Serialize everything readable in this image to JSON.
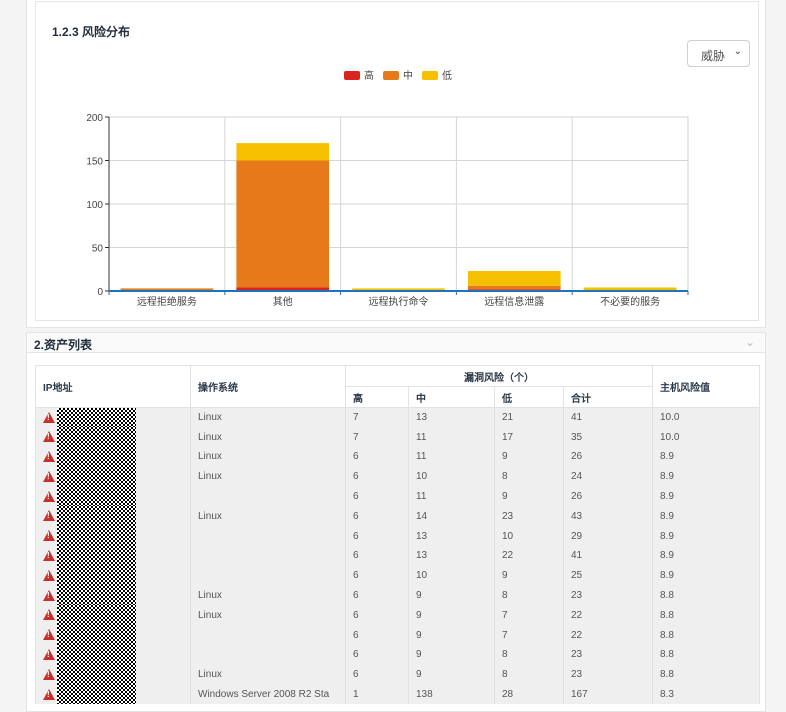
{
  "section1": {
    "title": "1.2.3 风险分布",
    "select_value": "威胁"
  },
  "chart_data": {
    "type": "bar",
    "stacked": true,
    "categories": [
      "远程拒绝服务",
      "其他",
      "远程执行命令",
      "远程信息泄露",
      "不必要的服务"
    ],
    "series": [
      {
        "name": "高",
        "color": "#d9251d",
        "values": [
          0,
          4,
          0,
          2,
          0
        ]
      },
      {
        "name": "中",
        "color": "#e67a1a",
        "values": [
          3,
          146,
          1,
          4,
          1
        ]
      },
      {
        "name": "低",
        "color": "#f5c000",
        "values": [
          0,
          20,
          2,
          17,
          3
        ]
      }
    ],
    "ylim": [
      0,
      200
    ],
    "yticks": [
      0,
      50,
      100,
      150,
      200
    ],
    "legend_position": "top-center",
    "grid": true
  },
  "section2": {
    "title": "2.资产列表",
    "headers": {
      "ip": "IP地址",
      "os": "操作系统",
      "vuln_group": "漏洞风险（个）",
      "high": "高",
      "mid": "中",
      "low": "低",
      "total": "合计",
      "host_risk": "主机风险值"
    },
    "rows": [
      {
        "os": "Linux",
        "high": "7",
        "mid": "13",
        "low": "21",
        "total": "41",
        "risk": "10.0"
      },
      {
        "os": "Linux",
        "high": "7",
        "mid": "11",
        "low": "17",
        "total": "35",
        "risk": "10.0"
      },
      {
        "os": "Linux",
        "high": "6",
        "mid": "11",
        "low": "9",
        "total": "26",
        "risk": "8.9"
      },
      {
        "os": "Linux",
        "high": "6",
        "mid": "10",
        "low": "8",
        "total": "24",
        "risk": "8.9"
      },
      {
        "os": "",
        "high": "6",
        "mid": "11",
        "low": "9",
        "total": "26",
        "risk": "8.9"
      },
      {
        "os": "Linux",
        "high": "6",
        "mid": "14",
        "low": "23",
        "total": "43",
        "risk": "8.9"
      },
      {
        "os": "",
        "high": "6",
        "mid": "13",
        "low": "10",
        "total": "29",
        "risk": "8.9"
      },
      {
        "os": "",
        "high": "6",
        "mid": "13",
        "low": "22",
        "total": "41",
        "risk": "8.9"
      },
      {
        "os": "",
        "high": "6",
        "mid": "10",
        "low": "9",
        "total": "25",
        "risk": "8.9"
      },
      {
        "os": "Linux",
        "high": "6",
        "mid": "9",
        "low": "8",
        "total": "23",
        "risk": "8.8"
      },
      {
        "os": "Linux",
        "high": "6",
        "mid": "9",
        "low": "7",
        "total": "22",
        "risk": "8.8"
      },
      {
        "os": "",
        "high": "6",
        "mid": "9",
        "low": "7",
        "total": "22",
        "risk": "8.8"
      },
      {
        "os": "",
        "high": "6",
        "mid": "9",
        "low": "8",
        "total": "23",
        "risk": "8.8"
      },
      {
        "os": "Linux",
        "high": "6",
        "mid": "9",
        "low": "8",
        "total": "23",
        "risk": "8.8"
      },
      {
        "os": "Windows Server 2008 R2 Sta",
        "high": "1",
        "mid": "138",
        "low": "28",
        "total": "167",
        "risk": "8.3"
      }
    ]
  },
  "icons": {
    "select_chevron": "chevron-down-icon",
    "section_chevron": "chevron-down-icon",
    "row_warning": "warning-icon"
  },
  "colors": {
    "high": "#d9251d",
    "mid": "#e67a1a",
    "low": "#f5c000",
    "axis": "#1e73be"
  }
}
